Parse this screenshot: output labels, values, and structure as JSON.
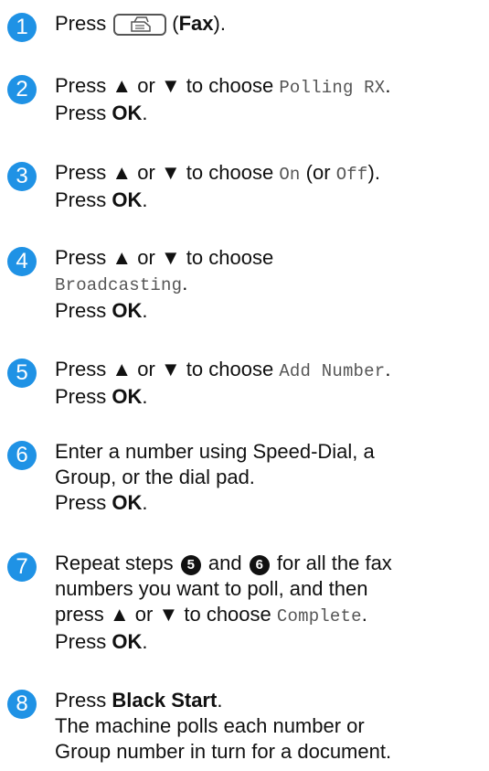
{
  "steps": [
    {
      "n": "1",
      "press": "Press",
      "fax_label": "Fax"
    },
    {
      "n": "2",
      "press": "Press ▲ or ▼ to choose",
      "mono": "Polling RX",
      "ok_prefix": "Press",
      "ok": "OK"
    },
    {
      "n": "3",
      "press": "Press ▲ or ▼ to choose",
      "mono_on": "On",
      "or": "(or",
      "mono_off": "Off",
      "close": ").",
      "ok_prefix": "Press",
      "ok": "OK"
    },
    {
      "n": "4",
      "press": "Press ▲ or ▼ to choose",
      "mono": "Broadcasting",
      "ok_prefix": "Press",
      "ok": "OK"
    },
    {
      "n": "5",
      "press": "Press ▲ or ▼ to choose",
      "mono": "Add Number",
      "ok_prefix": "Press",
      "ok": "OK"
    },
    {
      "n": "6",
      "line1": "Enter a number using Speed-Dial, a",
      "line2": "Group, or the dial pad.",
      "ok_prefix": "Press",
      "ok": "OK"
    },
    {
      "n": "7",
      "repeat": "Repeat steps",
      "ref1": "5",
      "and": "and",
      "ref2": "6",
      "tail": "for all the fax",
      "line2": "numbers you want to poll, and then",
      "line3": "press ▲ or ▼ to choose",
      "mono": "Complete",
      "ok_prefix": "Press",
      "ok": "OK"
    },
    {
      "n": "8",
      "press": "Press",
      "bold": "Black Start",
      "line2": "The machine polls each number or",
      "line3": "Group number in turn for a document."
    }
  ],
  "icons": {
    "fax": "fax-icon",
    "step_marker": "blue-number-circle"
  },
  "colors": {
    "step_marker": "#1f92e5",
    "mono_text": "#555555"
  }
}
